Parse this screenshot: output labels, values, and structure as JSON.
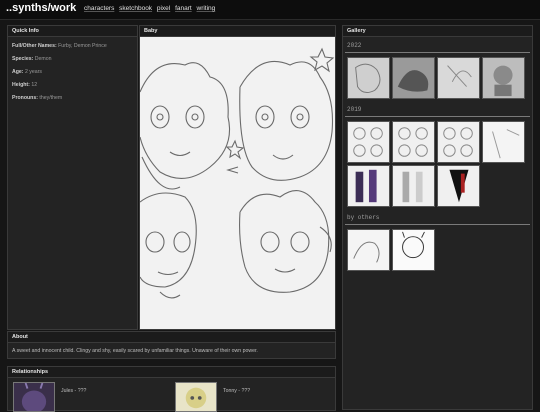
{
  "header": {
    "title": "..synths/work",
    "nav": [
      "characters",
      "sketchbook",
      "pixel",
      "fanart",
      "writing"
    ]
  },
  "quick_info": {
    "heading": "Quick Info",
    "rows": [
      {
        "label": "Full/Other Names:",
        "value": "Furby, Demon Prince"
      },
      {
        "label": "Species:",
        "value": "Demon"
      },
      {
        "label": "Age:",
        "value": "2 years"
      },
      {
        "label": "Height:",
        "value": "12"
      },
      {
        "label": "Pronouns:",
        "value": "they/them"
      }
    ]
  },
  "image_panel": {
    "heading": "Baby"
  },
  "about": {
    "heading": "About",
    "text": "A sweet and innocent child. Clingy and shy, easily scared by unfamiliar things. Unaware of their own power."
  },
  "relationships": {
    "heading": "Relationships",
    "items": [
      {
        "name": "Jules - ???"
      },
      {
        "name": "Tonny - ???"
      }
    ]
  },
  "gallery": {
    "heading": "Gallery",
    "sections": [
      {
        "label": "2022"
      },
      {
        "label": "2019"
      },
      {
        "label": "by others"
      }
    ]
  }
}
